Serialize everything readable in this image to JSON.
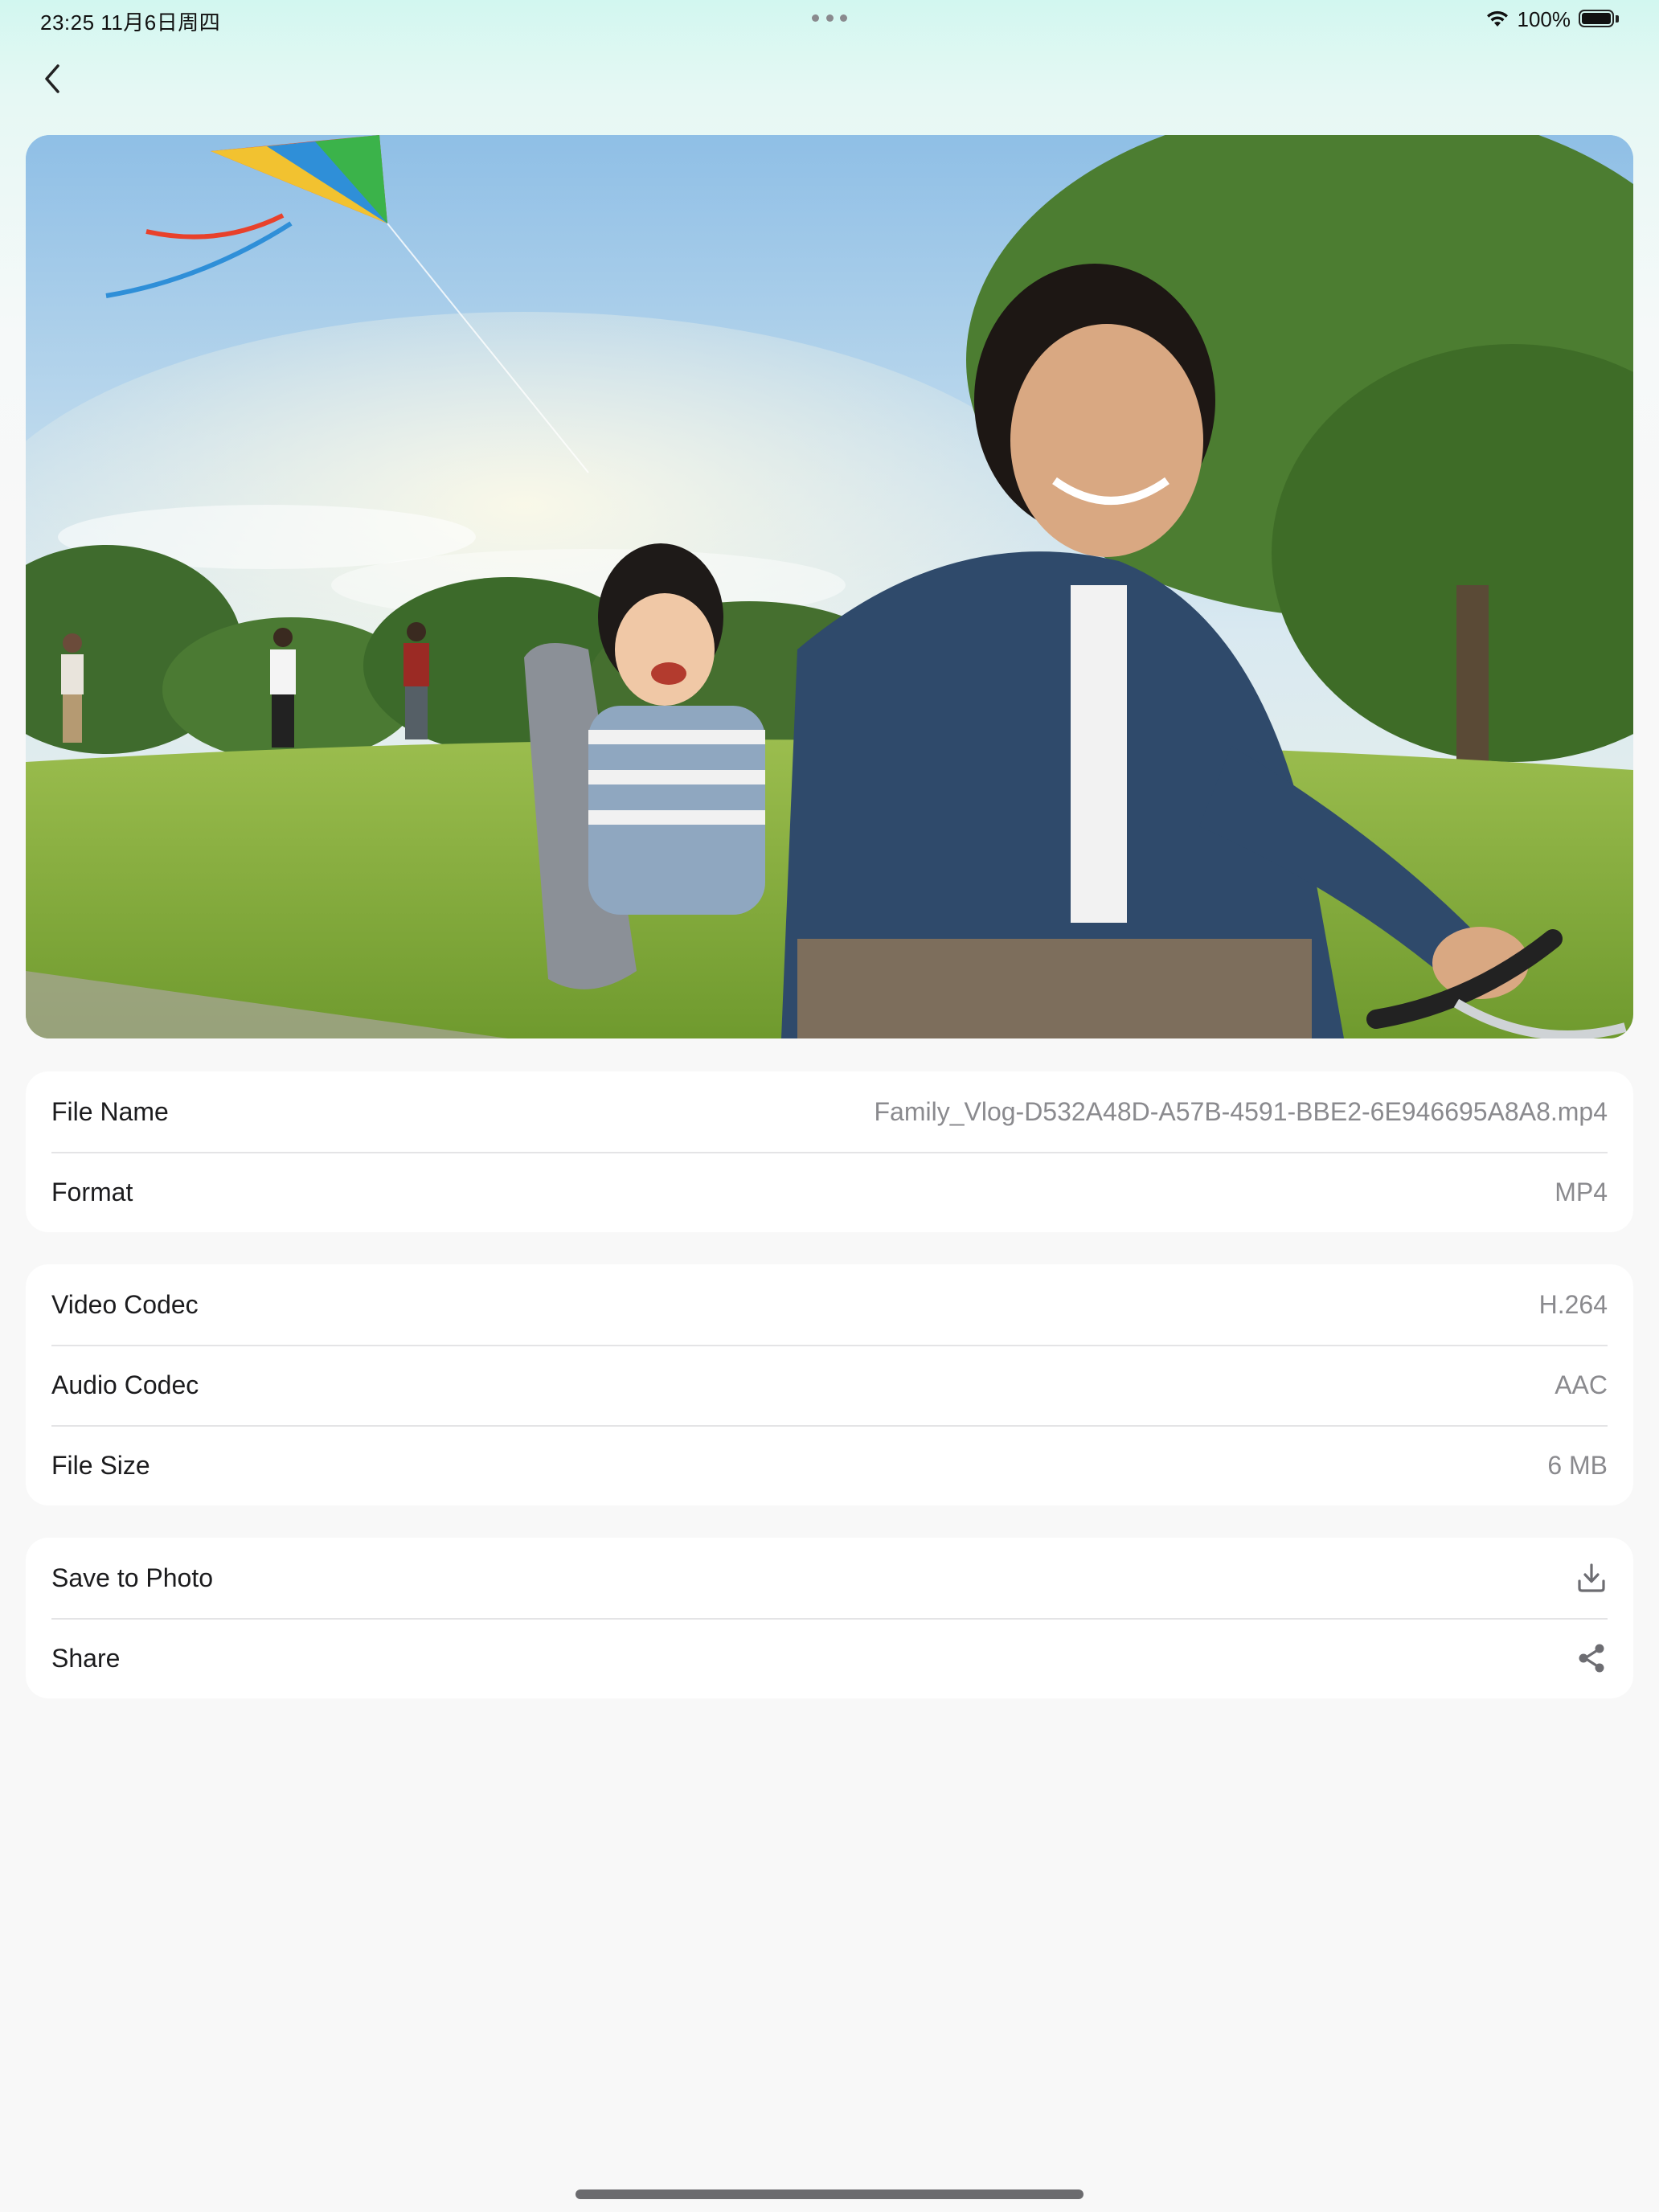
{
  "status_bar": {
    "time": "23:25  11月6日周四",
    "battery_percent": "100%",
    "battery_level": 1.0,
    "icons": [
      "wifi-icon",
      "battery-icon",
      "more-dots-icon"
    ]
  },
  "nav": {
    "back_icon": "chevron-left-icon"
  },
  "media": {
    "kind": "video-preview"
  },
  "file_info": [
    {
      "label": "File Name",
      "value": "Family_Vlog-D532A48D-A57B-4591-BBE2-6E946695A8A8.mp4"
    },
    {
      "label": "Format",
      "value": "MP4"
    }
  ],
  "codec_info": [
    {
      "label": "Video Codec",
      "value": "H.264"
    },
    {
      "label": "Audio Codec",
      "value": "AAC"
    },
    {
      "label": "File Size",
      "value": "6 MB"
    }
  ],
  "actions": [
    {
      "label": "Save to Photo",
      "icon": "download-icon"
    },
    {
      "label": "Share",
      "icon": "share-icon"
    }
  ],
  "colors": {
    "background_top": "#d2f7f0",
    "background": "#f8f8f8",
    "card": "#ffffff",
    "label": "#1c1c1e",
    "secondary": "#8a8a8e",
    "separator": "#e4e4e6"
  }
}
